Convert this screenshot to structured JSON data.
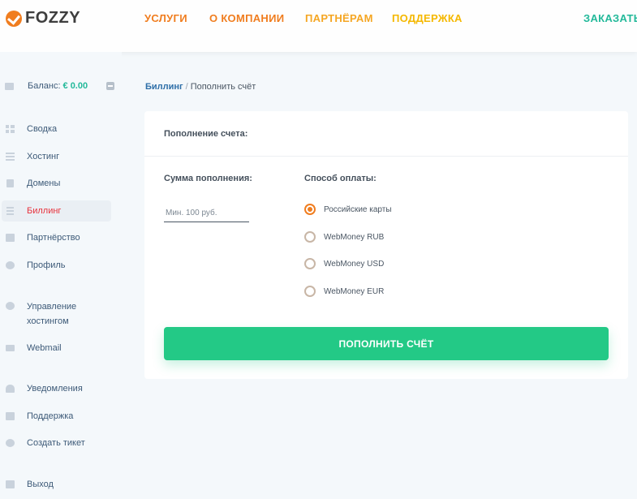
{
  "header": {
    "logo_text": "FOZZY",
    "nav": [
      "Услуги",
      "О компании",
      "Партнёрам",
      "Поддержка"
    ],
    "order_label": "Заказать"
  },
  "sidebar": {
    "balance_label": "Баланс:",
    "balance_value": "€ 0.00",
    "items": [
      {
        "label": "Сводка",
        "icon": "dashboard-icon"
      },
      {
        "label": "Хостинг",
        "icon": "server-icon"
      },
      {
        "label": "Домены",
        "icon": "domain-icon"
      },
      {
        "label": "Биллинг",
        "icon": "billing-icon",
        "active": true
      },
      {
        "label": "Партнёрство",
        "icon": "briefcase-icon"
      },
      {
        "label": "Профиль",
        "icon": "user-icon"
      },
      {
        "label": "Управление хостингом",
        "icon": "gear-icon"
      },
      {
        "label": "Webmail",
        "icon": "mail-icon"
      },
      {
        "label": "Уведомления",
        "icon": "bell-icon"
      },
      {
        "label": "Поддержка",
        "icon": "chat-icon"
      },
      {
        "label": "Создать тикет",
        "icon": "plus-circle-icon"
      },
      {
        "label": "Выход",
        "icon": "logout-icon"
      }
    ]
  },
  "breadcrumb": {
    "parent": "Биллинг",
    "separator": "/",
    "current": "Пополнить счёт"
  },
  "form": {
    "title": "Пополнение счета:",
    "amount_label": "Сумма пополнения:",
    "amount_placeholder": "Мин. 100 руб.",
    "amount_value": "",
    "payment_label": "Способ оплаты:",
    "payment_options": [
      "Российские карты",
      "WebMoney RUB",
      "WebMoney USD",
      "WebMoney EUR"
    ],
    "selected_option": "Российские карты",
    "submit_label": "Пополнить счёт"
  },
  "colors": {
    "accent_orange": "#f07d1f",
    "accent_green": "#23c986",
    "active_red": "#e8323c",
    "link_blue": "#2e6fa8"
  }
}
